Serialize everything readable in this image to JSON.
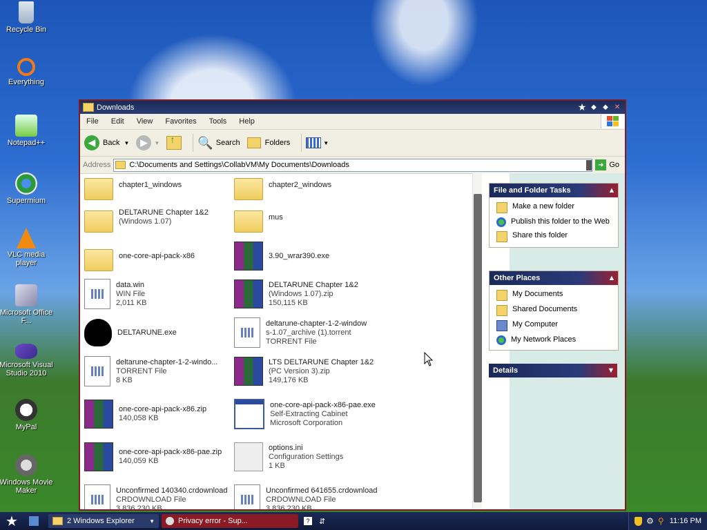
{
  "desktop": {
    "icons": [
      {
        "label": "Recycle Bin"
      },
      {
        "label": "Everything"
      },
      {
        "label": "Notepad++"
      },
      {
        "label": "Supermium"
      },
      {
        "label": "VLC media player"
      },
      {
        "label": "Microsoft Office F..."
      },
      {
        "label": "Microsoft Visual Studio 2010"
      },
      {
        "label": "MyPal"
      },
      {
        "label": "Windows Movie Maker"
      }
    ]
  },
  "window": {
    "title": "Downloads",
    "menu": [
      "File",
      "Edit",
      "View",
      "Favorites",
      "Tools",
      "Help"
    ],
    "toolbar": {
      "back": "Back",
      "search": "Search",
      "folders": "Folders"
    },
    "address": {
      "label": "Address",
      "path": "C:\\Documents and Settings\\CollabVM\\My Documents\\Downloads",
      "go": "Go"
    },
    "files": [
      {
        "name": "chapter1_windows",
        "l2": "",
        "l3": "",
        "type": "folder"
      },
      {
        "name": "chapter2_windows",
        "l2": "",
        "l3": "",
        "type": "folder"
      },
      {
        "name": "DELTARUNE Chapter 1&2",
        "l2": "(Windows 1.07)",
        "l3": "",
        "type": "folder"
      },
      {
        "name": "mus",
        "l2": "",
        "l3": "",
        "type": "folder"
      },
      {
        "name": "one-core-api-pack-x86",
        "l2": "",
        "l3": "",
        "type": "folder"
      },
      {
        "name": "3.90_wrar390.exe",
        "l2": "",
        "l3": "",
        "type": "rar"
      },
      {
        "name": "data.win",
        "l2": "WIN File",
        "l3": "2,011 KB",
        "type": "doc"
      },
      {
        "name": "DELTARUNE Chapter 1&2",
        "l2": "(Windows 1.07).zip",
        "l3": "150,115 KB",
        "type": "rar"
      },
      {
        "name": "DELTARUNE.exe",
        "l2": "",
        "l3": "",
        "type": "heart"
      },
      {
        "name": "deltarune-chapter-1-2-window",
        "l2": "s-1.07_archive (1).torrent",
        "l3": "TORRENT File",
        "type": "doc"
      },
      {
        "name": "deltarune-chapter-1-2-windo...",
        "l2": "TORRENT File",
        "l3": "8 KB",
        "type": "doc"
      },
      {
        "name": "LTS DELTARUNE Chapter 1&2",
        "l2": "(PC Version 3).zip",
        "l3": "149,176 KB",
        "type": "rar"
      },
      {
        "name": "one-core-api-pack-x86.zip",
        "l2": "140,058 KB",
        "l3": "",
        "type": "rar"
      },
      {
        "name": "one-core-api-pack-x86-pae.exe",
        "l2": "Self-Extracting Cabinet",
        "l3": "Microsoft Corporation",
        "type": "exe"
      },
      {
        "name": "one-core-api-pack-x86-pae.zip",
        "l2": "140,059 KB",
        "l3": "",
        "type": "rar"
      },
      {
        "name": "options.ini",
        "l2": "Configuration Settings",
        "l3": "1 KB",
        "type": "ini"
      },
      {
        "name": "Unconfirmed 140340.crdownload",
        "l2": "CRDOWNLOAD File",
        "l3": "3,836,230 KB",
        "type": "doc"
      },
      {
        "name": "Unconfirmed 641655.crdownload",
        "l2": "CRDOWNLOAD File",
        "l3": "3,836,230 KB",
        "type": "doc"
      }
    ],
    "tasks": {
      "file_folder": {
        "title": "File and Folder Tasks",
        "items": [
          "Make a new folder",
          "Publish this folder to the Web",
          "Share this folder"
        ]
      },
      "other_places": {
        "title": "Other Places",
        "items": [
          "My Documents",
          "Shared Documents",
          "My Computer",
          "My Network Places"
        ]
      },
      "details": {
        "title": "Details"
      }
    }
  },
  "taskbar": {
    "explorer_group": "2 Windows Explorer",
    "browser": "Privacy error - Sup...",
    "clock": "11:16 PM"
  }
}
